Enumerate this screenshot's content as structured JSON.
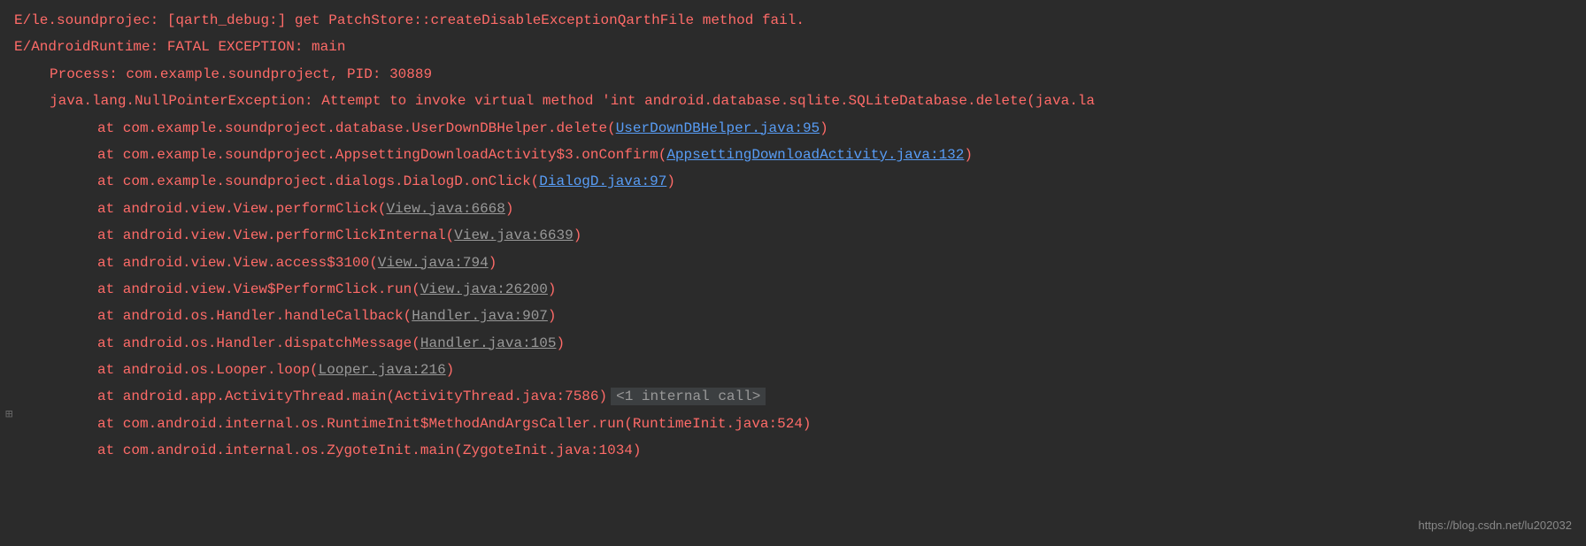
{
  "log": {
    "line1": "E/le.soundprojec: [qarth_debug:]  get PatchStore::createDisableExceptionQarthFile method fail.",
    "line2": "E/AndroidRuntime: FATAL EXCEPTION: main",
    "line3": "Process: com.example.soundproject, PID: 30889",
    "line4": "java.lang.NullPointerException: Attempt to invoke virtual method 'int android.database.sqlite.SQLiteDatabase.delete(java.la",
    "trace": [
      {
        "prefix": "at com.example.soundproject.database.UserDownDBHelper.delete(",
        "link": "UserDownDBHelper.java:95",
        "linkType": "blue",
        "suffix": ")"
      },
      {
        "prefix": "at com.example.soundproject.AppsettingDownloadActivity$3.onConfirm(",
        "link": "AppsettingDownloadActivity.java:132",
        "linkType": "blue",
        "suffix": ")"
      },
      {
        "prefix": "at com.example.soundproject.dialogs.DialogD.onClick(",
        "link": "DialogD.java:97",
        "linkType": "blue",
        "suffix": ")"
      },
      {
        "prefix": "at android.view.View.performClick(",
        "link": "View.java:6668",
        "linkType": "gray",
        "suffix": ")"
      },
      {
        "prefix": "at android.view.View.performClickInternal(",
        "link": "View.java:6639",
        "linkType": "gray",
        "suffix": ")"
      },
      {
        "prefix": "at android.view.View.access$3100(",
        "link": "View.java:794",
        "linkType": "gray",
        "suffix": ")"
      },
      {
        "prefix": "at android.view.View$PerformClick.run(",
        "link": "View.java:26200",
        "linkType": "gray",
        "suffix": ")"
      },
      {
        "prefix": "at android.os.Handler.handleCallback(",
        "link": "Handler.java:907",
        "linkType": "gray",
        "suffix": ")"
      },
      {
        "prefix": "at android.os.Handler.dispatchMessage(",
        "link": "Handler.java:105",
        "linkType": "gray",
        "suffix": ")"
      },
      {
        "prefix": "at android.os.Looper.loop(",
        "link": "Looper.java:216",
        "linkType": "gray",
        "suffix": ")"
      },
      {
        "prefix": "at android.app.ActivityThread.main(ActivityThread.java:7586)",
        "link": "",
        "linkType": "none",
        "suffix": "",
        "internal": "<1 internal call>"
      },
      {
        "prefix": "at com.android.internal.os.RuntimeInit$MethodAndArgsCaller.run(RuntimeInit.java:524)",
        "link": "",
        "linkType": "none",
        "suffix": ""
      },
      {
        "prefix": "at com.android.internal.os.ZygoteInit.main(ZygoteInit.java:1034)",
        "link": "",
        "linkType": "none",
        "suffix": ""
      }
    ]
  },
  "watermark": "https://blog.csdn.net/lu202032",
  "expandIcon": "⊞"
}
